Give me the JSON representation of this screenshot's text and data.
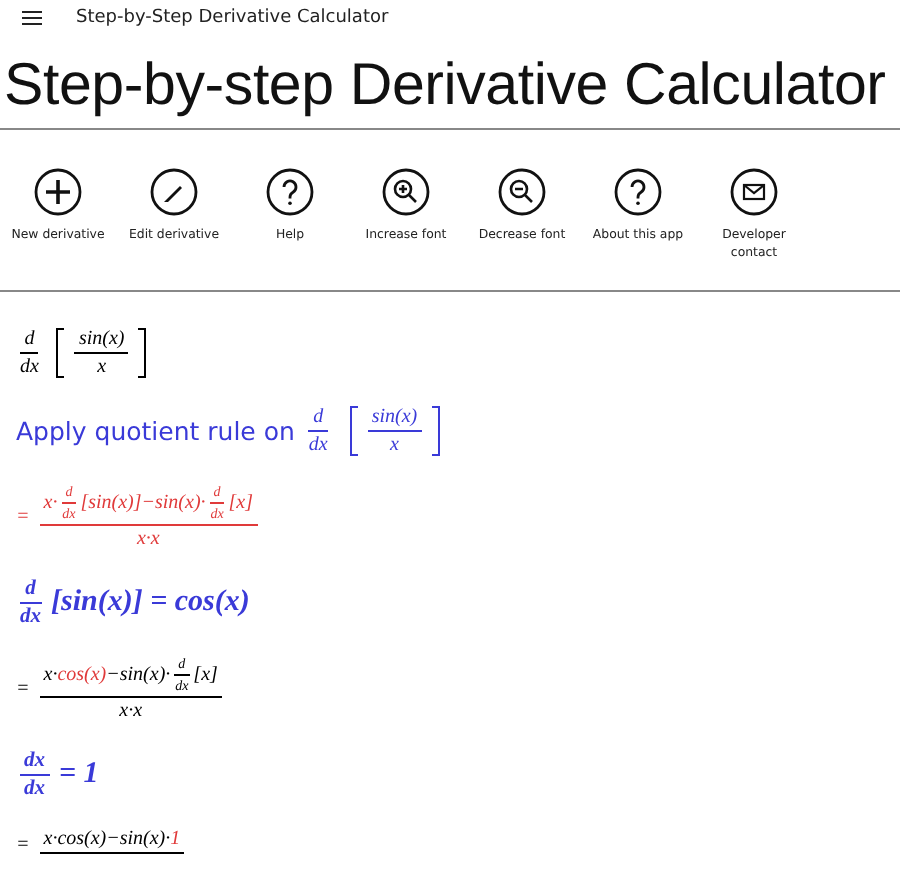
{
  "titlebar": {
    "title": "Step-by-Step Derivative Calculator"
  },
  "heading": "Step-by-step Derivative Calculator",
  "toolbar": [
    {
      "kind": "plus",
      "label": "New derivative"
    },
    {
      "kind": "pencil",
      "label": "Edit derivative"
    },
    {
      "kind": "question",
      "label": "Help"
    },
    {
      "kind": "zoom-in",
      "label": "Increase font"
    },
    {
      "kind": "zoom-out",
      "label": "Decrease font"
    },
    {
      "kind": "question",
      "label": "About this app"
    },
    {
      "kind": "mail",
      "label": "Developer contact"
    }
  ],
  "steps": [
    {
      "kind": "expr",
      "color": "#000000",
      "parts": [
        {
          "kind": "frac",
          "num": [
            {
              "kind": "text",
              "text": "d"
            }
          ],
          "den": [
            {
              "kind": "text",
              "text": "dx"
            }
          ]
        },
        {
          "kind": "brack",
          "body": [
            {
              "kind": "frac",
              "num": [
                {
                  "kind": "text",
                  "text": "sin(x)"
                }
              ],
              "den": [
                {
                  "kind": "text",
                  "text": "x"
                }
              ]
            }
          ]
        }
      ]
    },
    {
      "kind": "note",
      "color": "#3a3ad8",
      "parts": [
        {
          "kind": "label",
          "text": "Apply quotient rule on"
        },
        {
          "kind": "frac",
          "num": [
            {
              "kind": "text",
              "text": "d"
            }
          ],
          "den": [
            {
              "kind": "text",
              "text": "dx"
            }
          ]
        },
        {
          "kind": "brack",
          "body": [
            {
              "kind": "frac",
              "num": [
                {
                  "kind": "text",
                  "text": "sin(x)"
                }
              ],
              "den": [
                {
                  "kind": "text",
                  "text": "x"
                }
              ]
            }
          ]
        }
      ]
    },
    {
      "kind": "expr",
      "color": "#e03a3a",
      "parts": [
        {
          "kind": "text",
          "text": "="
        },
        {
          "kind": "frac",
          "num": [
            {
              "kind": "text",
              "text": "x·"
            },
            {
              "kind": "frac",
              "num": [
                {
                  "kind": "text",
                  "text": "d"
                }
              ],
              "den": [
                {
                  "kind": "text",
                  "text": "dx"
                }
              ]
            },
            {
              "kind": "text",
              "text": "[sin(x)]−sin(x)·"
            },
            {
              "kind": "frac",
              "num": [
                {
                  "kind": "text",
                  "text": "d"
                }
              ],
              "den": [
                {
                  "kind": "text",
                  "text": "dx"
                }
              ]
            },
            {
              "kind": "text",
              "text": "[x]"
            }
          ],
          "den": [
            {
              "kind": "text",
              "text": "x·x"
            }
          ]
        }
      ]
    },
    {
      "kind": "result",
      "color": "#3a3ad8",
      "parts": [
        {
          "kind": "frac",
          "num": [
            {
              "kind": "text",
              "text": "d"
            }
          ],
          "den": [
            {
              "kind": "text",
              "text": "dx"
            }
          ]
        },
        {
          "kind": "text",
          "text": "[sin(x)] = cos(x)"
        }
      ]
    },
    {
      "kind": "expr",
      "color": "#000000",
      "parts": [
        {
          "kind": "text",
          "text": "="
        },
        {
          "kind": "frac",
          "num": [
            {
              "kind": "text",
              "text": "x·"
            },
            {
              "kind": "text",
              "text": "cos(x)",
              "highlight": true
            },
            {
              "kind": "text",
              "text": "−sin(x)·"
            },
            {
              "kind": "frac",
              "num": [
                {
                  "kind": "text",
                  "text": "d"
                }
              ],
              "den": [
                {
                  "kind": "text",
                  "text": "dx"
                }
              ]
            },
            {
              "kind": "text",
              "text": "[x]"
            }
          ],
          "den": [
            {
              "kind": "text",
              "text": "x·x"
            }
          ]
        }
      ]
    },
    {
      "kind": "result",
      "color": "#3a3ad8",
      "parts": [
        {
          "kind": "frac",
          "num": [
            {
              "kind": "text",
              "text": "dx"
            }
          ],
          "den": [
            {
              "kind": "text",
              "text": "dx"
            }
          ]
        },
        {
          "kind": "text",
          "text": "= 1"
        }
      ]
    },
    {
      "kind": "expr",
      "color": "#000000",
      "parts": [
        {
          "kind": "text",
          "text": "="
        },
        {
          "kind": "frac",
          "num": [
            {
              "kind": "text",
              "text": "x·cos(x)−sin(x)·"
            },
            {
              "kind": "text",
              "text": "1",
              "highlight": true
            }
          ]
        }
      ]
    }
  ]
}
